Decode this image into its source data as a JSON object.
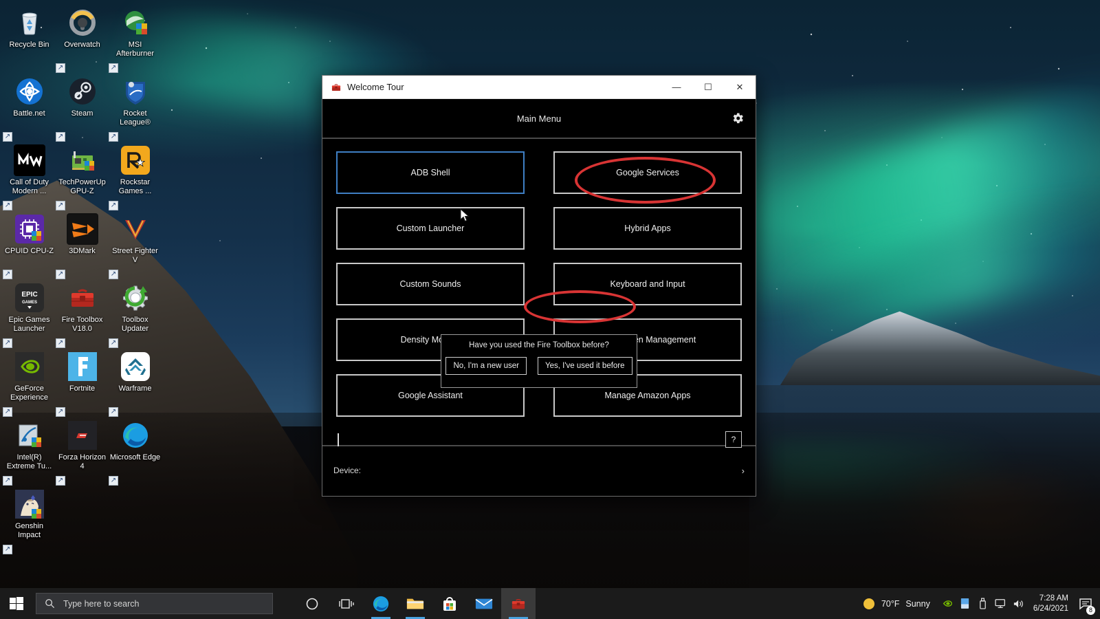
{
  "desktop": {
    "icons": [
      {
        "label": "Recycle Bin",
        "icon": "recycle-bin-icon",
        "shortcut": false
      },
      {
        "label": "Overwatch",
        "icon": "overwatch-icon",
        "shortcut": true
      },
      {
        "label": "MSI Afterburner",
        "icon": "msi-afterburner-icon",
        "shortcut": true
      },
      {
        "label": "Battle.net",
        "icon": "battlenet-icon",
        "shortcut": true
      },
      {
        "label": "Steam",
        "icon": "steam-icon",
        "shortcut": true
      },
      {
        "label": "Rocket League®",
        "icon": "rocket-league-icon",
        "shortcut": true
      },
      {
        "label": "Call of Duty Modern ...",
        "icon": "call-of-duty-icon",
        "shortcut": true
      },
      {
        "label": "TechPowerUp GPU-Z",
        "icon": "gpuz-icon",
        "shortcut": true
      },
      {
        "label": "Rockstar Games ...",
        "icon": "rockstar-games-icon",
        "shortcut": true
      },
      {
        "label": "CPUID CPU-Z",
        "icon": "cpuz-icon",
        "shortcut": true
      },
      {
        "label": "3DMark",
        "icon": "3dmark-icon",
        "shortcut": true
      },
      {
        "label": "Street Fighter V",
        "icon": "street-fighter-v-icon",
        "shortcut": true
      },
      {
        "label": "Epic Games Launcher",
        "icon": "epic-games-icon",
        "shortcut": true
      },
      {
        "label": "Fire Toolbox V18.0",
        "icon": "fire-toolbox-icon",
        "shortcut": true
      },
      {
        "label": "Toolbox Updater",
        "icon": "toolbox-updater-icon",
        "shortcut": true
      },
      {
        "label": "GeForce Experience",
        "icon": "geforce-experience-icon",
        "shortcut": true
      },
      {
        "label": "Fortnite",
        "icon": "fortnite-icon",
        "shortcut": true
      },
      {
        "label": "Warframe",
        "icon": "warframe-icon",
        "shortcut": true
      },
      {
        "label": "Intel(R) Extreme Tu...",
        "icon": "intel-xtu-icon",
        "shortcut": true
      },
      {
        "label": "Forza Horizon 4",
        "icon": "forza-horizon-4-icon",
        "shortcut": true
      },
      {
        "label": "Microsoft Edge",
        "icon": "microsoft-edge-icon",
        "shortcut": true
      },
      {
        "label": "Genshin Impact",
        "icon": "genshin-impact-icon",
        "shortcut": true
      }
    ]
  },
  "window": {
    "title": "Welcome Tour",
    "title_icon": "fire-toolbox-icon",
    "controls": {
      "minimize": "—",
      "maximize": "☐",
      "close": "✕"
    },
    "header": {
      "title": "Main Menu",
      "settings_icon": "gear-icon"
    },
    "buttons": [
      {
        "label": "ADB Shell",
        "focused": true
      },
      {
        "label": "Google Services",
        "focused": false
      },
      {
        "label": "Custom Launcher",
        "focused": false
      },
      {
        "label": "Hybrid Apps",
        "focused": false
      },
      {
        "label": "Custom Sounds",
        "focused": false
      },
      {
        "label": "Keyboard and Input",
        "focused": false
      },
      {
        "label": "Density Modfier",
        "focused": false
      },
      {
        "label": "Lockscreen Management",
        "focused": false
      },
      {
        "label": "Google Assistant",
        "focused": false
      },
      {
        "label": "Manage Amazon Apps",
        "focused": false
      }
    ],
    "command_line": {
      "value": "",
      "help_label": "?"
    },
    "footer": {
      "device_label": "Device:",
      "chevron": "›"
    }
  },
  "dialog": {
    "question": "Have you used the Fire Toolbox before?",
    "buttons": [
      {
        "label": "No, I'm a new user"
      },
      {
        "label": "Yes, I've used it before"
      }
    ]
  },
  "annotations": {
    "color": "#d83434",
    "items": [
      {
        "name": "google-services-highlight"
      },
      {
        "name": "yes-used-before-highlight"
      }
    ]
  },
  "taskbar": {
    "start_icon": "windows-start-icon",
    "search": {
      "placeholder": "Type here to search",
      "value": "",
      "icon": "search-icon"
    },
    "items": [
      {
        "name": "cortana-icon",
        "open": false
      },
      {
        "name": "task-view-icon",
        "open": false
      },
      {
        "name": "microsoft-edge-icon",
        "open": true
      },
      {
        "name": "file-explorer-icon",
        "open": true
      },
      {
        "name": "microsoft-store-icon",
        "open": false
      },
      {
        "name": "mail-icon",
        "open": false
      },
      {
        "name": "fire-toolbox-icon",
        "open": true,
        "active": true
      }
    ],
    "weather": {
      "temperature": "70°F",
      "condition": "Sunny",
      "icon": "sun-icon"
    },
    "tray_icons": [
      {
        "name": "nvidia-icon"
      },
      {
        "name": "removable-drive-icon"
      },
      {
        "name": "usb-eject-icon"
      },
      {
        "name": "network-icon"
      },
      {
        "name": "volume-icon"
      }
    ],
    "clock": {
      "time": "7:28 AM",
      "date": "6/24/2021"
    },
    "notifications": {
      "icon": "action-center-icon",
      "count": "8"
    }
  }
}
